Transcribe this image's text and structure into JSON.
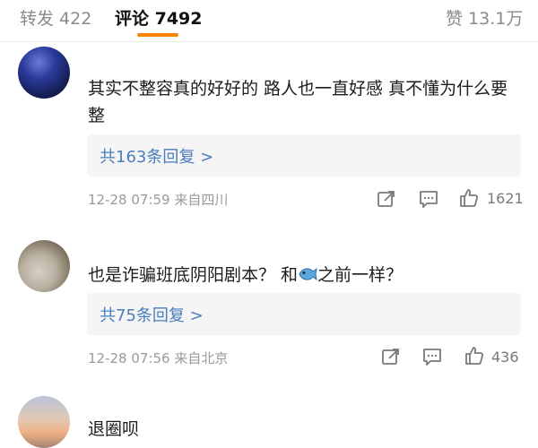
{
  "tabs": {
    "repost": "转发 422",
    "comments": "评论 7492",
    "likes": "赞 13.1万"
  },
  "comments": [
    {
      "text": "其实不整容真的好好的 路人也一直好感 真不懂为什么要整",
      "replies": "共163条回复 >",
      "meta": "12-28 07:59 来自四川",
      "likes": "1621"
    },
    {
      "text_before": "也是诈骗班底阴阳剧本？  和",
      "text_after": "之前一样？",
      "inline_icon": "fish-emoji-icon",
      "replies": "共75条回复 >",
      "meta": "12-28 07:56 来自北京",
      "likes": "436"
    },
    {
      "text": "退圈呗"
    }
  ],
  "colors": {
    "accent": "#ff8200",
    "link": "#4a7dbd",
    "meta": "#9a9a9a"
  },
  "icons": [
    "share-icon",
    "comment-icon",
    "like-icon"
  ]
}
